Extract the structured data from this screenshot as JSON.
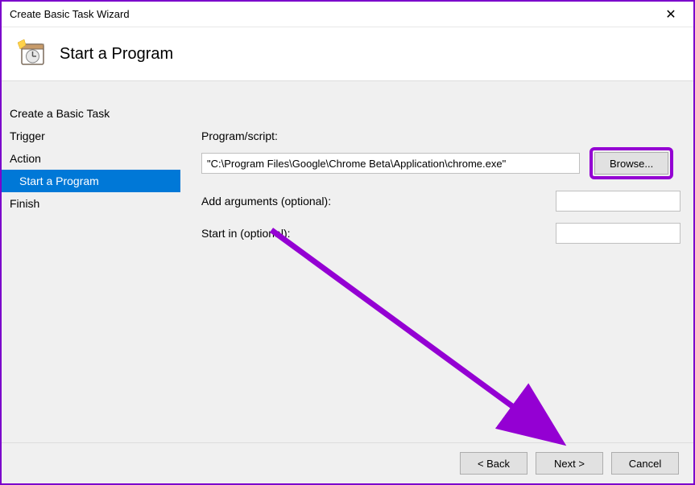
{
  "titlebar": {
    "title": "Create Basic Task Wizard",
    "close_glyph": "✕"
  },
  "header": {
    "title": "Start a Program"
  },
  "sidebar": {
    "items": [
      {
        "label": "Create a Basic Task",
        "selected": false,
        "indent": false
      },
      {
        "label": "Trigger",
        "selected": false,
        "indent": false
      },
      {
        "label": "Action",
        "selected": false,
        "indent": false
      },
      {
        "label": "Start a Program",
        "selected": true,
        "indent": true
      },
      {
        "label": "Finish",
        "selected": false,
        "indent": false
      }
    ]
  },
  "form": {
    "program_label": "Program/script:",
    "program_value": "\"C:\\Program Files\\Google\\Chrome Beta\\Application\\chrome.exe\"",
    "browse_label": "Browse...",
    "args_label": "Add arguments (optional):",
    "args_value": "",
    "startin_label": "Start in (optional):",
    "startin_value": ""
  },
  "footer": {
    "back_label": "< Back",
    "next_label": "Next >",
    "cancel_label": "Cancel"
  },
  "annotation": {
    "color": "#9400d3"
  }
}
